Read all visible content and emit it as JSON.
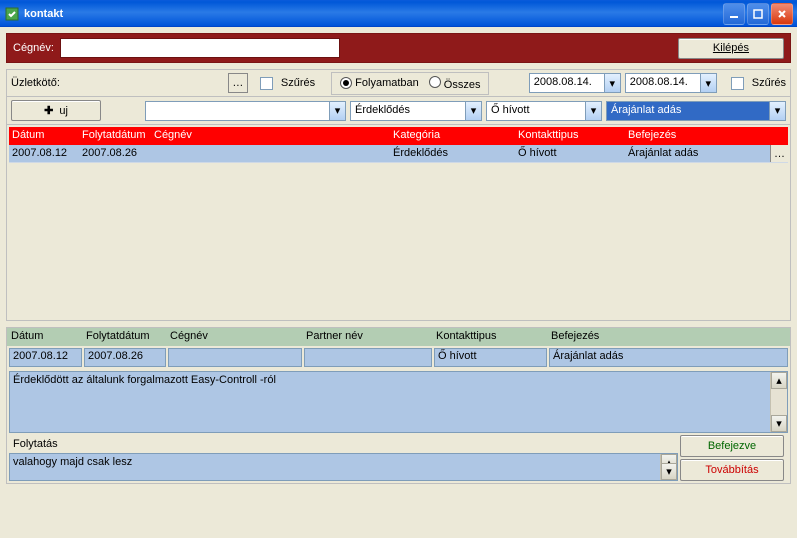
{
  "window": {
    "title": "kontakt"
  },
  "header": {
    "cegnev_label": "Cégnév:",
    "cegnev_value": "",
    "exit_label": "Kilépés"
  },
  "filter1": {
    "uzletkoto_label": "Üzletkötő:",
    "szures_label": "Szűrés",
    "radio_folyamatban": "Folyamatban",
    "radio_osszes": "Összes",
    "date1": "2008.08.14.",
    "date2": "2008.08.14.",
    "szures2_label": "Szűrés"
  },
  "filter2": {
    "uj_label": "uj",
    "combo_ceg": "",
    "combo_kat": "Érdeklődés",
    "combo_kont": "Ő hívott",
    "combo_bef": "Árajánlat adás"
  },
  "grid": {
    "headers": {
      "datum": "Dátum",
      "folyt": "Folytatdátum",
      "cegnev": "Cégnév",
      "kategoria": "Kategória",
      "kontakt": "Kontakttipus",
      "befejezes": "Befejezés"
    },
    "row": {
      "datum": "2007.08.12",
      "folyt": "2007.08.26",
      "ceg": "",
      "kat": "Érdeklődés",
      "kont": "Ő hívott",
      "bef": "Árajánlat adás"
    }
  },
  "detail": {
    "headers": {
      "datum": "Dátum",
      "folyt": "Folytatdátum",
      "cegnev": "Cégnév",
      "partner": "Partner név",
      "kontakt": "Kontakttipus",
      "befejezes": "Befejezés"
    },
    "values": {
      "datum": "2007.08.12",
      "folyt": "2007.08.26",
      "ceg": "",
      "partner": "",
      "kont": "Ő hívott",
      "bef": "Árajánlat adás"
    },
    "memo1": "Érdeklődött az általunk forgalmazott Easy-Controll -ról",
    "folytatas_label": "Folytatás",
    "memo2": "valahogy majd csak lesz",
    "btn_befejezve": "Befejezve",
    "btn_tovabbitas": "Továbbítás"
  }
}
